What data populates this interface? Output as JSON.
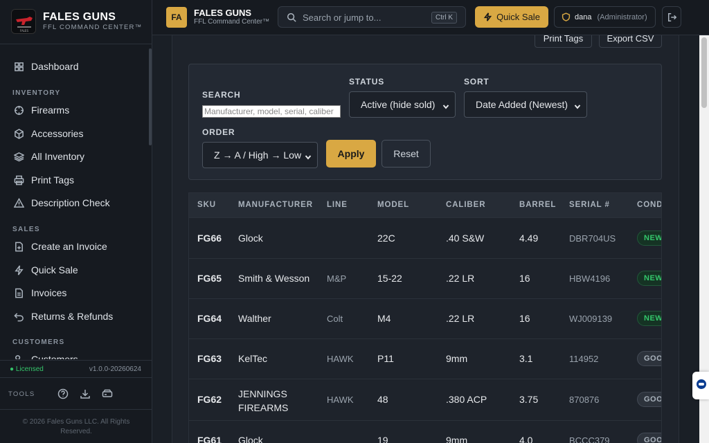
{
  "brand": {
    "title": "FALES GUNS",
    "subtitle": "FFL COMMAND CENTER™"
  },
  "sidebar": {
    "items": [
      {
        "label": "Dashboard",
        "icon": "dashboard-icon"
      },
      {
        "label": "Firearms",
        "icon": "crosshair-icon"
      },
      {
        "label": "Accessories",
        "icon": "box-icon"
      },
      {
        "label": "All Inventory",
        "icon": "layers-icon"
      },
      {
        "label": "Print Tags",
        "icon": "printer-icon"
      },
      {
        "label": "Description Check",
        "icon": "warning-icon"
      },
      {
        "label": "Create an Invoice",
        "icon": "file-plus-icon"
      },
      {
        "label": "Quick Sale",
        "icon": "lightning-icon"
      },
      {
        "label": "Invoices",
        "icon": "file-icon"
      },
      {
        "label": "Returns & Refunds",
        "icon": "return-icon"
      },
      {
        "label": "Customers",
        "icon": "users-icon"
      }
    ],
    "sections": {
      "inventory": "INVENTORY",
      "sales": "SALES",
      "customers": "CUSTOMERS"
    },
    "licensed": "● Licensed",
    "version": "v1.0.0-20260624",
    "tools_label": "TOOLS",
    "copyright": "© 2026 Fales Guns LLC. All Rights Reserved."
  },
  "topbar": {
    "badge": "FA",
    "title": "FALES GUNS",
    "subtitle": "FFL Command Center™",
    "search_placeholder": "Search or jump to...",
    "shortcut": "Ctrl K",
    "quick_sale": "Quick Sale",
    "user": "dana",
    "role": "(Administrator)"
  },
  "header_buttons": {
    "print_tags": "Print Tags",
    "export_csv": "Export CSV"
  },
  "filters": {
    "search_label": "SEARCH",
    "search_placeholder": "Manufacturer, model, serial, caliber",
    "status_label": "STATUS",
    "status_value": "Active (hide sold)",
    "sort_label": "SORT",
    "sort_value": "Date Added (Newest)",
    "order_label": "ORDER",
    "order_value": "Z → A / High → Low",
    "apply": "Apply",
    "reset": "Reset"
  },
  "table": {
    "columns": [
      "SKU",
      "MANUFACTURER",
      "LINE",
      "MODEL",
      "CALIBER",
      "BARREL",
      "SERIAL #",
      "CONDITION"
    ],
    "rows": [
      {
        "sku": "FG66",
        "manufacturer": "Glock",
        "line": "",
        "model": "22C",
        "caliber": ".40 S&W",
        "barrel": "4.49",
        "serial": "DBR704US",
        "condition": "NEW",
        "cond_type": "new"
      },
      {
        "sku": "FG65",
        "manufacturer": "Smith & Wesson",
        "line": "M&P",
        "model": "15-22",
        "caliber": ".22 LR",
        "barrel": "16",
        "serial": "HBW4196",
        "condition": "NEW",
        "cond_type": "new"
      },
      {
        "sku": "FG64",
        "manufacturer": "Walther",
        "line": "Colt",
        "model": "M4",
        "caliber": ".22 LR",
        "barrel": "16",
        "serial": "WJ009139",
        "condition": "NEW",
        "cond_type": "new"
      },
      {
        "sku": "FG63",
        "manufacturer": "KelTec",
        "line": "HAWK",
        "model": "P11",
        "caliber": "9mm",
        "barrel": "3.1",
        "serial": "114952",
        "condition": "GOOD",
        "cond_type": "good"
      },
      {
        "sku": "FG62",
        "manufacturer": "JENNINGS FIREARMS",
        "line": "HAWK",
        "model": "48",
        "caliber": ".380 ACP",
        "barrel": "3.75",
        "serial": "870876",
        "condition": "GOOD",
        "cond_type": "good"
      },
      {
        "sku": "FG61",
        "manufacturer": "Glock",
        "line": "",
        "model": "19",
        "caliber": "9mm",
        "barrel": "4.0",
        "serial": "BCCC379",
        "condition": "GOOD",
        "cond_type": "good"
      }
    ]
  },
  "colors": {
    "accent": "#d9a843",
    "bg": "#1a1f26",
    "sidebar": "#161a20",
    "success": "#34c76b"
  }
}
